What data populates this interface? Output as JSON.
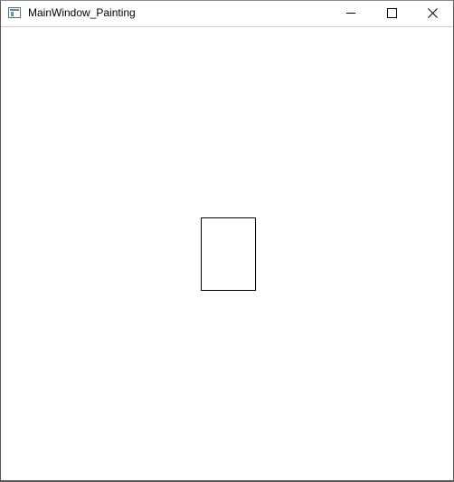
{
  "window": {
    "title": "MainWindow_Painting",
    "app_icon": "app-window-icon",
    "controls": {
      "minimize_icon": "minimize-icon",
      "maximize_icon": "maximize-icon",
      "close_icon": "close-icon"
    }
  },
  "canvas": {
    "background": "#ffffff",
    "shape": {
      "type": "rectangle",
      "stroke": "#000000",
      "fill": "none"
    }
  }
}
